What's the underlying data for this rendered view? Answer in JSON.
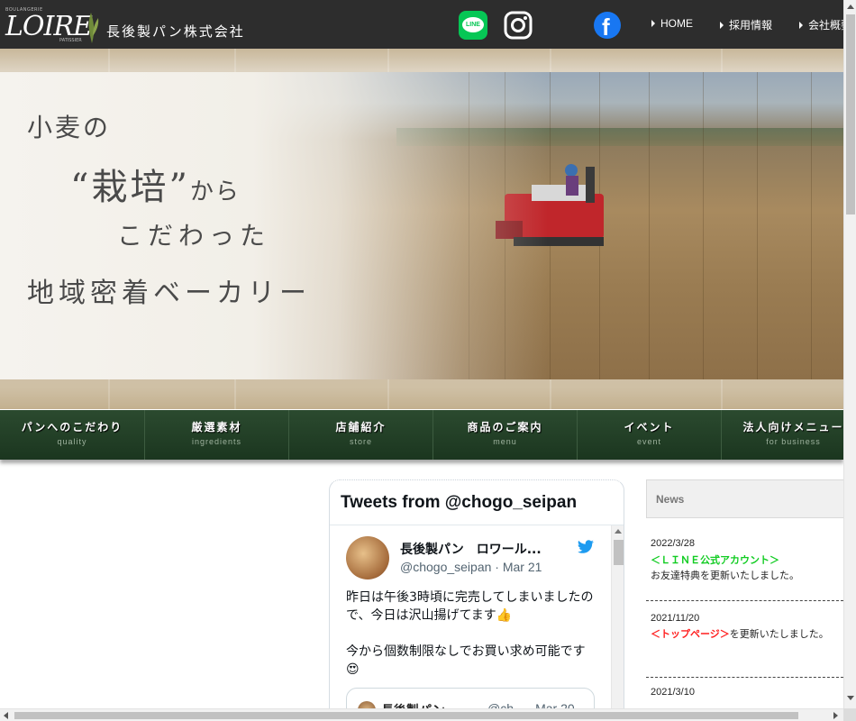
{
  "header": {
    "logo_text": "LOIRE",
    "logo_tagline": "BOULANGERIE",
    "logo_sub": "PATISSIER",
    "company_name": "長後製パン株式会社",
    "social": {
      "line_label": "LINE"
    },
    "nav": [
      {
        "label": "HOME"
      },
      {
        "label": "採用情報"
      },
      {
        "label": "会社概要"
      }
    ]
  },
  "hero": {
    "line1": "小麦の",
    "line2_main": "“栽培”",
    "line2_small": "から",
    "line3": "こだわった",
    "line4": "地域密着ベーカリー"
  },
  "menu": [
    {
      "jp": "パンへのこだわり",
      "en": "quality"
    },
    {
      "jp": "厳選素材",
      "en": "ingredients"
    },
    {
      "jp": "店舗紹介",
      "en": "store"
    },
    {
      "jp": "商品のご案内",
      "en": "menu"
    },
    {
      "jp": "イベント",
      "en": "event"
    },
    {
      "jp": "法人向けメニュー",
      "en": "for business"
    }
  ],
  "twitter": {
    "title": "Tweets from @chogo_seipan",
    "tweet": {
      "name": "長後製パン　ロワール...",
      "handle": "@chogo_seipan · Mar 21",
      "text1": "昨日は午後3時頃に完売してしまいましたので、今日は沢山揚げてます👍",
      "text2": "今から個数制限なしでお買い求め可能です😍"
    },
    "quote": {
      "name": "長後製パン...",
      "handle": "@ch... · Mar 20"
    }
  },
  "news": {
    "title": "News",
    "items": [
      {
        "date": "2022/3/28",
        "link": "＜ＬＩＮＥ公式アカウント＞",
        "text": "お友達特典を更新いたしました。"
      },
      {
        "date": "2021/11/20",
        "link": "＜トップページ＞",
        "text": "を更新いたしました。"
      },
      {
        "date": "2021/3/10",
        "link": "",
        "text": ""
      }
    ]
  },
  "colors": {
    "header_bg": "#2d2d2d",
    "menu_green": "#1e3a22",
    "line_green": "#06c755",
    "twitter_blue": "#1d9bf0",
    "facebook_blue": "#1877f2",
    "news_link_red": "#ff2020",
    "news_link_green": "#11cc22"
  }
}
